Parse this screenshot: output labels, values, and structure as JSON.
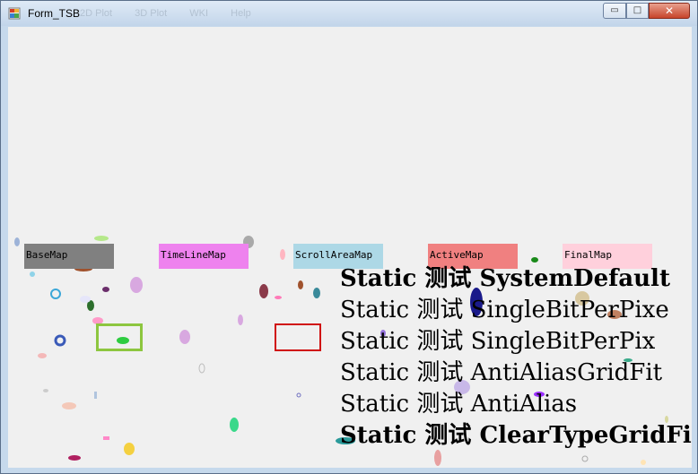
{
  "window": {
    "title": "Form_TSB",
    "controls": {
      "minimize": "▭",
      "maximize": "□",
      "close": "✕"
    },
    "ghost_menu": [
      "2D Plot",
      "3D Plot",
      "WKI",
      "Help"
    ]
  },
  "maps": [
    {
      "label": "BaseMap",
      "color": "#808080"
    },
    {
      "label": "TimeLineMap",
      "color": "#ee82ee"
    },
    {
      "label": "ScrollAreaMap",
      "color": "#add8e6"
    },
    {
      "label": "ActiveMap",
      "color": "#f08080"
    },
    {
      "label": "FinalMap",
      "color": "#ffd0dc"
    }
  ],
  "frames": [
    {
      "name": "green-frame",
      "color": "#8dc63f"
    },
    {
      "name": "red-frame",
      "color": "#d01010"
    }
  ],
  "static_lines": [
    {
      "text": "Static 测试 SystemDefault",
      "bold": true
    },
    {
      "text": "Static 测试 SingleBitPerPixe",
      "bold": false
    },
    {
      "text": "Static 测试 SingleBitPerPix",
      "bold": false
    },
    {
      "text": "Static 测试 AntiAliasGridFit",
      "bold": false
    },
    {
      "text": "Static 测试 AntiAlias",
      "bold": false
    },
    {
      "text": "Static 测试 ClearTypeGridFi",
      "bold": true
    }
  ]
}
